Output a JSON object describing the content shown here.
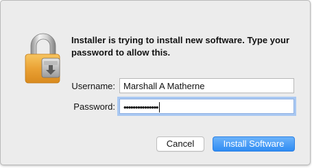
{
  "dialog": {
    "message": "Installer is trying to install new software. Type your password to allow this.",
    "icon": "lock-icon"
  },
  "username": {
    "label": "Username:",
    "value": "Marshall A Matherne"
  },
  "password": {
    "label": "Password:",
    "masked_value": "•••••••••••••••"
  },
  "buttons": {
    "cancel_label": "Cancel",
    "install_label": "Install Software"
  },
  "colors": {
    "accent": "#2f8cf3",
    "lock_body": "#e59a2b",
    "focus_ring": "#a9c8f2"
  }
}
